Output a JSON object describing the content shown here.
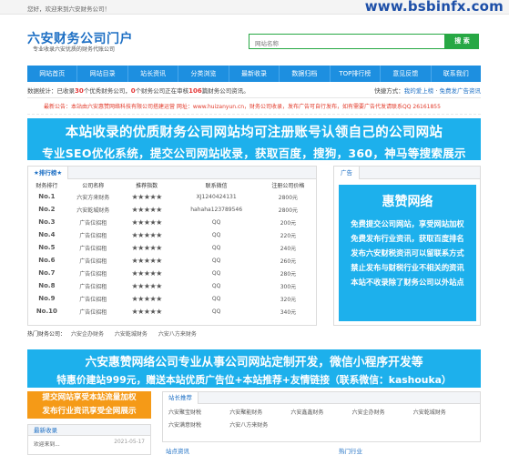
{
  "topbar": {
    "welcome": "您好，欢迎来到六安财务公司！",
    "watermark": "www.bsbinfx.com"
  },
  "header": {
    "title": "六安财务公司门户",
    "subtitle": "专业收录六安优质的财务代账公司",
    "search_placeholder": "网站名称",
    "search_button": "搜 索"
  },
  "nav": [
    "网站首页",
    "网站目录",
    "站长资讯",
    "分类浏览",
    "最新收录",
    "数据归档",
    "TOP排行榜",
    "意见反馈",
    "联系我们"
  ],
  "stats": {
    "prefix": "数据统计：已收录",
    "sites": "30",
    "mid1": "个优秀财务公司，",
    "pending": "0",
    "mid2": "个财务公司正在审核",
    "articles": "106",
    "mid3": "篇财务公司资讯。",
    "shortcut_label": "快捷方式：",
    "login": "我的爱上榜",
    "spacer": " · ",
    "publish": "免费发广告资讯"
  },
  "announcement": "最新公告：本站由六安惠赞网络科技有限公司搭建运营 网址：www.huizanyun.cn，财务公司收录，发布广告可自行发布，如有需要广告代发请联系QQ 26161855",
  "banner": {
    "line1": "本站收录的优质财务公司网站均可注册账号认领自己的公司网站",
    "line2": "专业SEO优化系统，提交公司网站收录，获取百度，搜狗，360，神马等搜索展示"
  },
  "ranking": {
    "tab": "★排行榜★",
    "headers": [
      "财务排行",
      "公司名称",
      "推荐指数",
      "联系微信",
      "注册公司价格"
    ],
    "rows": [
      {
        "rank": "No.1",
        "name": "六安方来财务",
        "stars": "★★★★★",
        "wechat": "XJ1240424131",
        "price": "2800元"
      },
      {
        "rank": "No.2",
        "name": "六安乾城财务",
        "stars": "★★★★★",
        "wechat": "hahaha123789546",
        "price": "2800元"
      },
      {
        "rank": "No.3",
        "name": "广告位招租",
        "stars": "★★★★★",
        "wechat": "QQ",
        "price": "200元"
      },
      {
        "rank": "No.4",
        "name": "广告位招租",
        "stars": "★★★★★",
        "wechat": "QQ",
        "price": "220元"
      },
      {
        "rank": "No.5",
        "name": "广告位招租",
        "stars": "★★★★★",
        "wechat": "QQ",
        "price": "240元"
      },
      {
        "rank": "No.6",
        "name": "广告位招租",
        "stars": "★★★★★",
        "wechat": "QQ",
        "price": "260元"
      },
      {
        "rank": "No.7",
        "name": "广告位招租",
        "stars": "★★★★★",
        "wechat": "QQ",
        "price": "280元"
      },
      {
        "rank": "No.8",
        "name": "广告位招租",
        "stars": "★★★★★",
        "wechat": "QQ",
        "price": "300元"
      },
      {
        "rank": "No.9",
        "name": "广告位招租",
        "stars": "★★★★★",
        "wechat": "QQ",
        "price": "320元"
      },
      {
        "rank": "No.10",
        "name": "广告位招租",
        "stars": "★★★★★",
        "wechat": "QQ",
        "price": "340元"
      }
    ]
  },
  "ad": {
    "tab": "广告",
    "title": "惠赞网络",
    "lines": [
      "免费提交公司网站，享受网站加权",
      "免费发布行业资讯，获取百度排名",
      "发布六安财税资讯可以留联系方式",
      "禁止发布与财税行业不相关的资讯",
      "本站不收录除了财务公司以外站点"
    ]
  },
  "hot": {
    "label": "热门财务公司：",
    "items": [
      "六安企办财务",
      "六安乾城财务",
      "六安八方来财务"
    ]
  },
  "banner2": {
    "line1": "六安惠赞网络公司专业从事公司网站定制开发，微信小程序开发等",
    "line2": "特惠价建站999元，赠送本站优质广告位+本站推荐+友情链接（联系微信：kashouka）"
  },
  "orange": {
    "line1": "提交网站享受本站流量加权",
    "line2": "发布行业资讯享受全网展示"
  },
  "newest": {
    "title": "最新收录",
    "item": "欢迎来到...",
    "date": "2021-05-17"
  },
  "recommend": {
    "tab": "站长推荐",
    "items": [
      "六安聚宝财税",
      "六安聚能财务",
      "六安鑫鑫财务",
      "六安企办财务",
      "六安乾城财务",
      "六安满意财税",
      "六安八方来财务"
    ]
  },
  "bottom_tabs": [
    "站点资讯",
    "热门行业"
  ],
  "colors": {
    "primary": "#1d8fe0",
    "banner": "#1db0ec",
    "accent_red": "#e53838",
    "green": "#27a844",
    "orange": "#f59a17"
  }
}
